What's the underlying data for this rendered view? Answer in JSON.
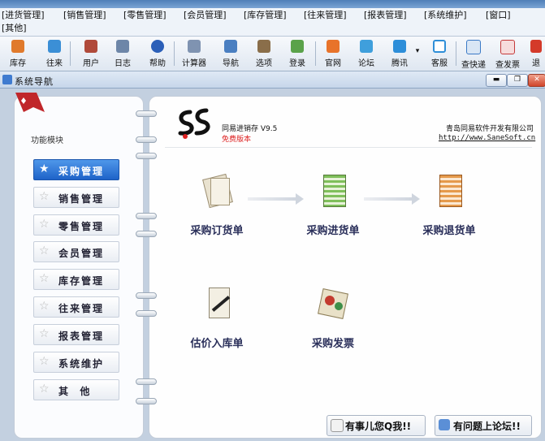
{
  "menu": {
    "row1": [
      "[进货管理]",
      "[销售管理]",
      "[零售管理]",
      "[会员管理]",
      "[库存管理]",
      "[往来管理]",
      "[报表管理]",
      "[系统维护]",
      "[窗口]"
    ],
    "row2": [
      "[其他]"
    ]
  },
  "toolbar": [
    "库存",
    "往来",
    "用户",
    "日志",
    "帮助",
    "计算器",
    "导航",
    "选项",
    "登录",
    "官网",
    "论坛",
    "腾讯",
    "客服",
    "查快递",
    "查发票",
    "退"
  ],
  "window": {
    "title": "系统导航"
  },
  "left": {
    "heading": "功能模块",
    "modules": [
      "采购管理",
      "销售管理",
      "零售管理",
      "会员管理",
      "库存管理",
      "往来管理",
      "报表管理",
      "系统维护",
      "其  他"
    ]
  },
  "header": {
    "product": "同易进销存 V9.5",
    "edition": "免费版本",
    "company": "青岛同易软件开发有限公司",
    "url": "http://www.SaneSoft.cn"
  },
  "functions": [
    "采购订货单",
    "采购进货单",
    "采购退货单",
    "估价入库单",
    "采购发票"
  ],
  "bottom": {
    "qq": "有事儿您Q我!!",
    "forum": "有问题上论坛!!"
  }
}
